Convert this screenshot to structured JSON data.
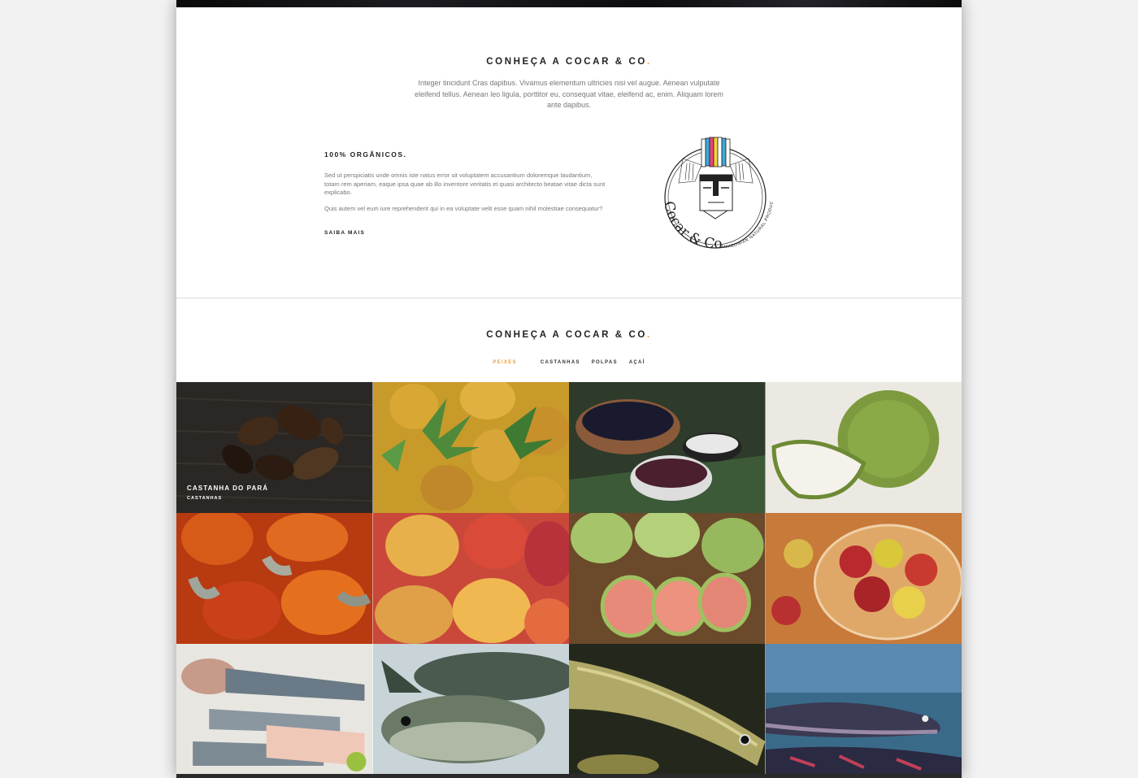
{
  "about": {
    "title": "CONHEÇA A COCAR & CO",
    "title_dot": ".",
    "intro": "Integer tincidunt Cras dapibus. Vivamus elementum ultricies nisi vel augue. Aenean vulputate eleifend tellus. Aenean leo ligula, porttitor eu, consequat vitae, eleifend ac, enim. Aliquam lorem ante dapibus."
  },
  "feature": {
    "heading": "100% ORGÂNICOS.",
    "paragraph1": "Sed ut perspiciatis unde omnis iste natus error sit voluptatem accusantium doloremque laudantium, totam rem aperiam, eaque ipsa quae ab illo inventore veritatis et quasi architecto beatae vitae dicta sunt explicabo.",
    "paragraph2": "Quis autem vel eum iure reprehenderit qui in ea voluptate velit esse quam nihil molestiae consequatur?",
    "link": "SAIBA MAIS"
  },
  "logo": {
    "brand": "Cocar & Co",
    "tagline": "AMAZONIAN NATURAL PRODUCTS"
  },
  "portfolio": {
    "title": "CONHEÇA A COCAR & CO",
    "title_dot": ".",
    "filters": [
      "PEIXES",
      "CASTANHAS",
      "POLPAS",
      "AÇAÍ"
    ],
    "active_filter": "PEIXES",
    "featured_caption": {
      "title": "CASTANHA DO PARÁ",
      "category": "CASTANHAS"
    }
  },
  "colors": {
    "accent": "#e8a23b",
    "text_dark": "#222222",
    "text_muted": "#777777"
  }
}
